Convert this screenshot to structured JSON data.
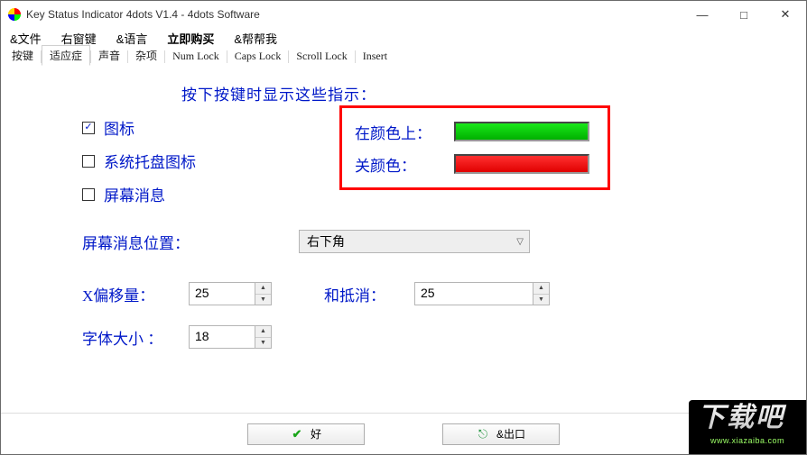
{
  "title": "Key Status Indicator 4dots V1.4 - 4dots Software",
  "menu": {
    "file": "&文件",
    "rightwin": "右窗键",
    "lang": "&语言",
    "buy": "立即购买",
    "help": "&帮帮我"
  },
  "tabs": {
    "t0": "按键",
    "t1": "适应症",
    "t2": "声音",
    "t3": "杂项",
    "t4": "Num Lock",
    "t5": "Caps Lock",
    "t6": "Scroll Lock",
    "t7": "Insert"
  },
  "heading": "按下按键时显示这些指示：",
  "checks": {
    "icon": "图标",
    "tray": "系统托盘图标",
    "screen": "屏幕消息"
  },
  "colors": {
    "onLabel": "在颜色上：",
    "offLabel": "关颜色：",
    "on": "#00c400",
    "off": "#ff1a1a"
  },
  "position": {
    "label": "屏幕消息位置：",
    "value": "右下角"
  },
  "offsets": {
    "xLabel": "X偏移量：",
    "xValue": "25",
    "yLabel": "和抵消：",
    "yValue": "25"
  },
  "font": {
    "label": "字体大小 ：",
    "value": "18"
  },
  "buttons": {
    "ok": "好",
    "exit": "&出口"
  },
  "watermark": {
    "text": "下载吧",
    "url": "www.xiazaiba.com"
  },
  "winbtns": {
    "min": "—",
    "max": "□",
    "close": "✕"
  }
}
